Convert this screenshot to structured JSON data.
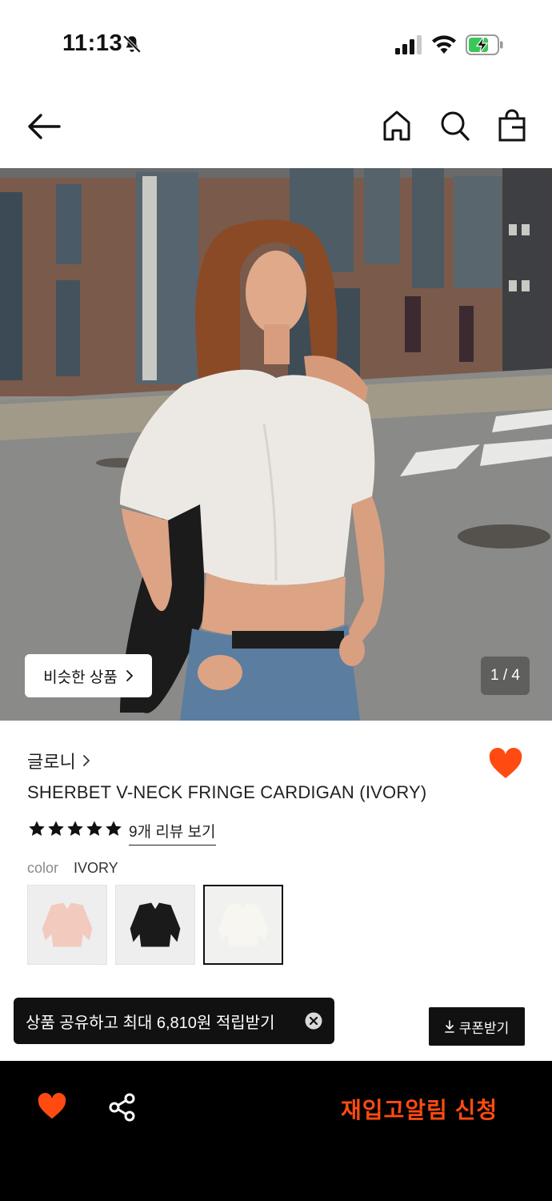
{
  "status_bar": {
    "time": "11:13",
    "icons": [
      "bell-slash-icon",
      "signal-icon",
      "wifi-icon",
      "battery-charging-icon"
    ]
  },
  "nav": {
    "icons": [
      "back-arrow-icon",
      "home-icon",
      "search-icon",
      "shopping-bag-icon"
    ]
  },
  "hero": {
    "similar_button_label": "비슷한 상품",
    "page_indicator": "1 / 4",
    "image_current": 1,
    "image_total": 4
  },
  "product": {
    "brand": "글로니",
    "name": "SHERBET V-NECK FRINGE CARDIGAN (IVORY)",
    "rating_stars": 5,
    "review_link": "9개 리뷰 보기",
    "color_label": "color",
    "color_value": "IVORY",
    "swatches": [
      "pink",
      "black",
      "ivory"
    ],
    "selected_swatch": "ivory",
    "wishlisted": true
  },
  "coupon": {
    "button_label": "쿠폰받기"
  },
  "toast": {
    "message": "상품 공유하고 최대 6,810원 적립받기"
  },
  "bottom_bar": {
    "restock_label": "재입고알림 신청"
  },
  "colors": {
    "accent_orange": "#ff4a12",
    "bottom_bar_bg": "#000000",
    "toast_bg": "#111111"
  }
}
